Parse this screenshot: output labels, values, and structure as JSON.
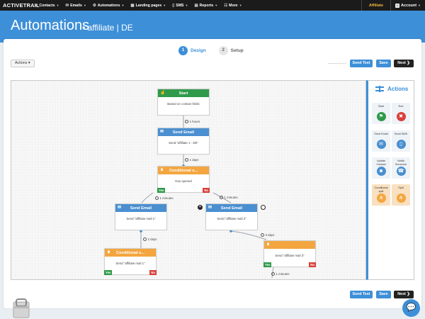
{
  "app": {
    "logo": "ACTIVETRAIL",
    "nav": [
      {
        "label": "Contacts",
        "icon": "person-icon"
      },
      {
        "label": "Emails",
        "icon": "envelope-icon"
      },
      {
        "label": "Automations",
        "icon": "gear-icon"
      },
      {
        "label": "Landing pages",
        "icon": "page-icon"
      },
      {
        "label": "SMS",
        "icon": "sms-icon"
      },
      {
        "label": "Reports",
        "icon": "chart-icon"
      },
      {
        "label": "More",
        "icon": "grid-icon"
      }
    ],
    "affiliate": "Affiliate",
    "account": "Account"
  },
  "header": {
    "title": "Automations",
    "subtitle": "• affiliate | DE"
  },
  "steps": [
    {
      "num": "1",
      "label": "Design"
    },
    {
      "num": "2",
      "label": "Setup"
    }
  ],
  "toolbar": {
    "actions_label": "Actions ▾",
    "send_test": "Send Test",
    "save": "Save",
    "next": "Next ❯"
  },
  "nodes": {
    "start": {
      "title": "Start",
      "body": "Based on contact fields"
    },
    "send1": {
      "title": "Send Email",
      "body": "Send \"affiliate 1 - DE\""
    },
    "cond1": {
      "title": "Conditional s...",
      "body": "Has opened",
      "yes": "Yes",
      "no": "No"
    },
    "send2": {
      "title": "Send Email",
      "body": "Send \"affiliate mail 1\""
    },
    "send3": {
      "title": "Send Email",
      "body": "Send \"affiliate mail 2\""
    },
    "cond2": {
      "title": "Conditional s...",
      "body": "Send \"affiliate mail 1\"",
      "yes": "Yes",
      "no": "No"
    },
    "cond3": {
      "body": "Send \"affiliate mail 3\"",
      "yes": "Yes",
      "no": "No"
    }
  },
  "delays": {
    "d1": "1 hours",
    "d2": "1 days",
    "d3": "1 minutes",
    "d4": "1 minutes",
    "d5": "2 days",
    "d6": "3 days",
    "d7": "1 minutes"
  },
  "panel": {
    "title": "Actions",
    "tiles": [
      {
        "label": "Start",
        "icon": "start-icon",
        "color": "#2f9a4a"
      },
      {
        "label": "End",
        "icon": "end-icon",
        "color": "#d9403a"
      },
      {
        "label": "Send Email",
        "icon": "email-icon",
        "color": "#4a8fd0"
      },
      {
        "label": "Send SMS",
        "icon": "sms-icon",
        "color": "#4a8fd0"
      },
      {
        "label": "Update Contact",
        "icon": "contact-icon",
        "color": "#4a8fd0"
      },
      {
        "label": "Notify Someone",
        "icon": "notify-icon",
        "color": "#4a8fd0"
      },
      {
        "label": "Conditional split",
        "icon": "conditional-split-icon",
        "color": "#f3a640"
      },
      {
        "label": "Split",
        "icon": "split-icon",
        "color": "#f3a640"
      }
    ]
  },
  "colors": {
    "brand": "#3d8fd8",
    "green": "#2f9a4a",
    "orange": "#f3a640",
    "red": "#d9403a",
    "affiliate": "#f2b43a"
  }
}
